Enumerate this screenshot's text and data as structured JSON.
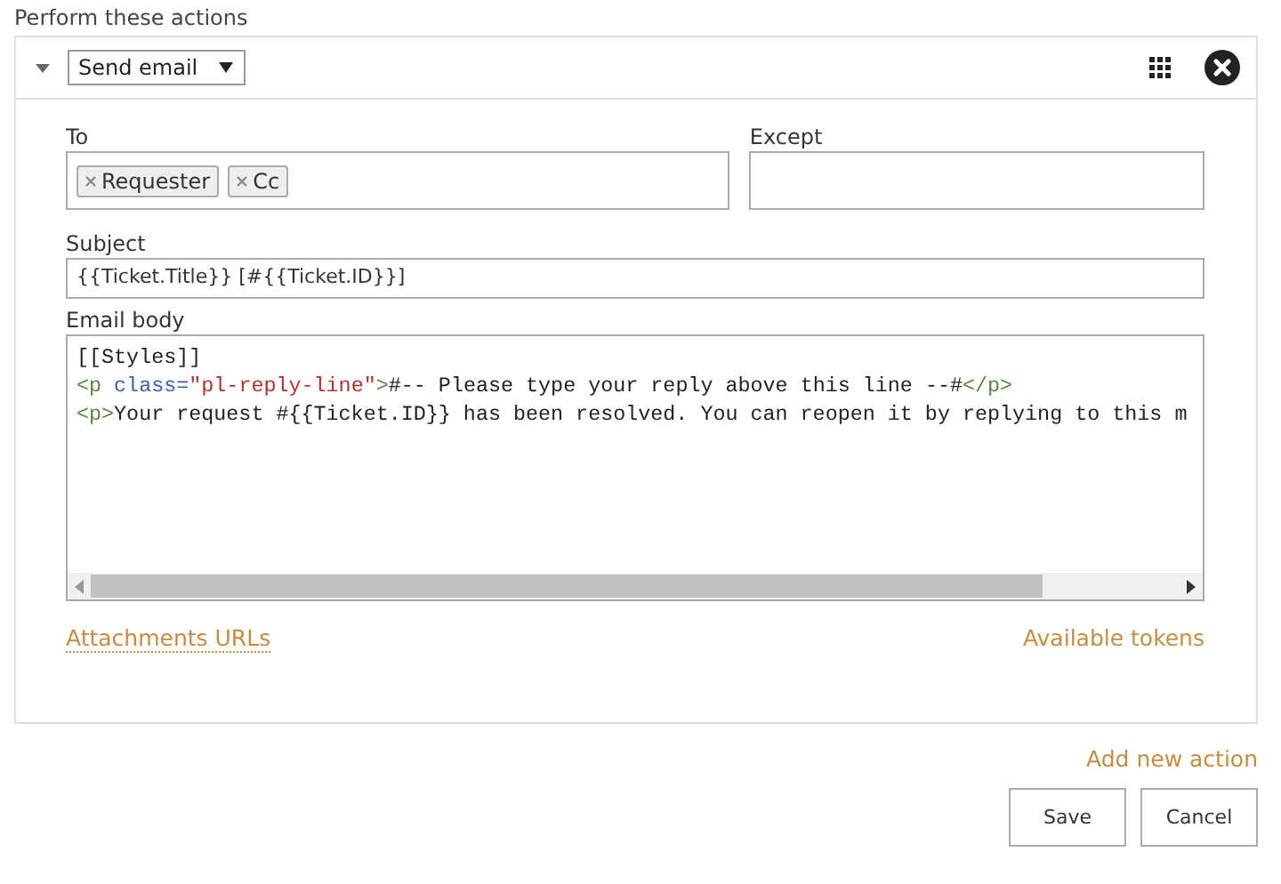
{
  "section_title": "Perform these actions",
  "action": {
    "expanded": true,
    "type": "Send email",
    "to": {
      "label": "To",
      "tokens": [
        "Requester",
        "Cc"
      ]
    },
    "except": {
      "label": "Except"
    },
    "subject": {
      "label": "Subject",
      "value": "{{Ticket.Title}} [#{{Ticket.ID}}]"
    },
    "body": {
      "label": "Email body",
      "lines": [
        [
          {
            "kind": "text",
            "text": "[[Styles]]"
          }
        ],
        [
          {
            "kind": "tag",
            "text": "<p "
          },
          {
            "kind": "attr",
            "text": "class="
          },
          {
            "kind": "value",
            "text": "\"pl-reply-line\""
          },
          {
            "kind": "tag",
            "text": ">"
          },
          {
            "kind": "text",
            "text": "#-- Please type your reply above this line --#"
          },
          {
            "kind": "tag",
            "text": "</p>"
          }
        ],
        [
          {
            "kind": "tag",
            "text": "<p>"
          },
          {
            "kind": "text",
            "text": "Your request #{{Ticket.ID}} has been resolved. You can reopen it by replying to this m"
          }
        ]
      ]
    },
    "links": [
      "Attachments URLs",
      "Available tokens"
    ]
  },
  "add_action": "Add new action",
  "buttons": [
    "Save",
    "Cancel"
  ]
}
